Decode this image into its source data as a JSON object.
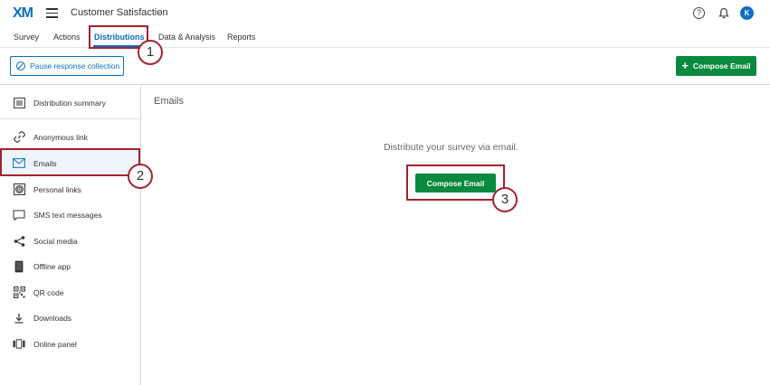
{
  "header": {
    "logo": "XM",
    "project_title": "Customer Satisfaction",
    "help": "?",
    "avatar_initial": "K"
  },
  "tabs": [
    {
      "label": "Survey"
    },
    {
      "label": "Actions"
    },
    {
      "label": "Distributions",
      "active": true
    },
    {
      "label": "Data & Analysis"
    },
    {
      "label": "Reports"
    }
  ],
  "toolbar": {
    "pause_label": "Pause response collection",
    "compose_label": "Compose Email"
  },
  "sidebar": {
    "items": [
      {
        "label": "Distribution summary",
        "icon": "list-icon"
      },
      {
        "label": "Anonymous link",
        "icon": "link-icon"
      },
      {
        "label": "Emails",
        "icon": "envelope-icon",
        "selected": true
      },
      {
        "label": "Personal links",
        "icon": "fingerprint-icon"
      },
      {
        "label": "SMS text messages",
        "icon": "speech-bubble-icon"
      },
      {
        "label": "Social media",
        "icon": "share-icon"
      },
      {
        "label": "Offline app",
        "icon": "tablet-icon"
      },
      {
        "label": "QR code",
        "icon": "qr-code-icon"
      },
      {
        "label": "Downloads",
        "icon": "download-icon"
      },
      {
        "label": "Online panel",
        "icon": "panel-icon"
      }
    ]
  },
  "main": {
    "title": "Emails",
    "message": "Distribute your survey via email.",
    "compose_label": "Compose Email"
  },
  "callouts": [
    "1",
    "2",
    "3"
  ],
  "colors": {
    "accent": "#0b6fc4",
    "primary_button": "#0a8a3e",
    "callout": "#a5222e"
  }
}
